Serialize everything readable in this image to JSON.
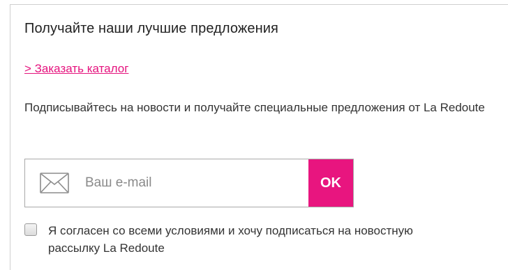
{
  "newsletter": {
    "title": "Получайте наши лучшие предложения",
    "catalog_link": "> Заказать каталог",
    "description": "Подписывайтесь на новости и получайте специальные предложения от La Redoute",
    "email_placeholder": "Ваш e-mail",
    "email_value": "",
    "submit_label": "OK",
    "consent_label": "Я согласен со всеми условиями и хочу подписаться на новостную рассылку La Redoute",
    "consent_checked": false
  },
  "colors": {
    "accent": "#e8157f",
    "link": "#e5127d",
    "text": "#333333",
    "border": "#a9a9a9"
  },
  "icons": {
    "email_field_icon": "envelope-icon"
  }
}
